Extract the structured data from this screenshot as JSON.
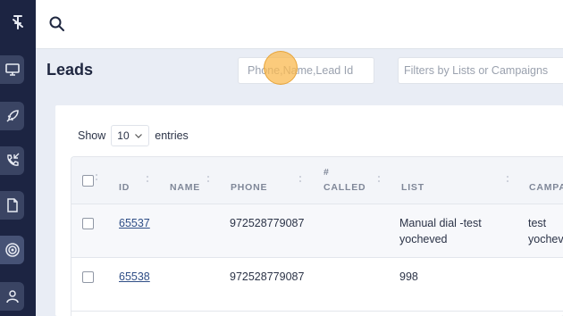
{
  "page": {
    "title": "Leads"
  },
  "topbar": {
    "search_icon": "search-icon"
  },
  "sidebar": {
    "items": [
      {
        "name": "monitor-icon"
      },
      {
        "name": "rocket-icon"
      },
      {
        "name": "phone-callback-icon"
      },
      {
        "name": "document-icon"
      },
      {
        "name": "target-icon"
      },
      {
        "name": "user-icon"
      }
    ]
  },
  "header": {
    "quick_search_placeholder": "Phone,Name,Lead Id",
    "filters_placeholder": "Filters by Lists or Campaigns"
  },
  "entries": {
    "show_label": "Show",
    "value": "10",
    "suffix": "entries"
  },
  "table": {
    "columns": [
      "ID",
      "NAME",
      "PHONE",
      "#",
      "CALLED",
      "LIST",
      "CAMPA"
    ],
    "rows": [
      {
        "id": "65537",
        "name": "",
        "phone": "972528779087",
        "called": "",
        "list_line1": "Manual dial -test",
        "list_line2": "yocheved",
        "campaign_line1": "test",
        "campaign_line2": "yochev"
      },
      {
        "id": "65538",
        "name": "",
        "phone": "972528779087",
        "called": "",
        "list_line1": "998",
        "list_line2": "",
        "campaign_line1": "",
        "campaign_line2": ""
      }
    ]
  },
  "colors": {
    "sidebar": "#1c2442",
    "accent_link": "#2f4e86",
    "click_marker": "#fab950"
  }
}
